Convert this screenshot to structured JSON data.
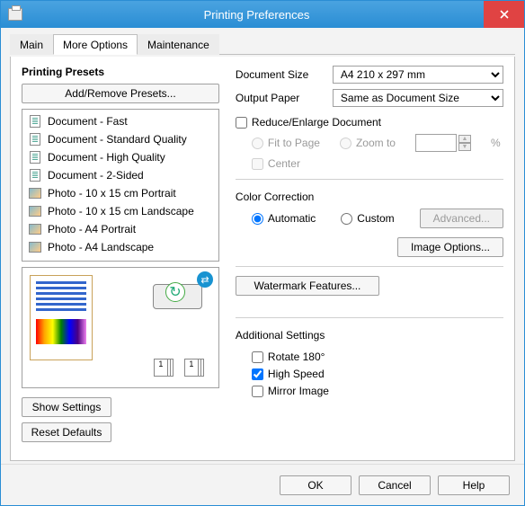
{
  "window": {
    "title": "Printing Preferences"
  },
  "tabs": {
    "main": "Main",
    "more": "More Options",
    "maint": "Maintenance"
  },
  "left": {
    "heading": "Printing Presets",
    "add_remove": "Add/Remove Presets...",
    "presets": [
      "Document - Fast",
      "Document - Standard Quality",
      "Document - High Quality",
      "Document - 2-Sided",
      "Photo - 10 x 15 cm Portrait",
      "Photo - 10 x 15 cm Landscape",
      "Photo - A4 Portrait",
      "Photo - A4 Landscape"
    ],
    "show_settings": "Show Settings",
    "reset_defaults": "Reset Defaults"
  },
  "right": {
    "doc_size_lbl": "Document Size",
    "doc_size_val": "A4 210 x 297 mm",
    "out_paper_lbl": "Output Paper",
    "out_paper_val": "Same as Document Size",
    "reduce_enlarge": "Reduce/Enlarge Document",
    "fit_to_page": "Fit to Page",
    "zoom_to": "Zoom to",
    "zoom_value": "",
    "percent": "%",
    "center": "Center",
    "color_corr": "Color Correction",
    "automatic": "Automatic",
    "custom": "Custom",
    "advanced": "Advanced...",
    "image_options": "Image Options...",
    "watermark": "Watermark Features...",
    "additional": "Additional Settings",
    "rotate": "Rotate 180°",
    "high_speed": "High Speed",
    "mirror": "Mirror Image"
  },
  "footer": {
    "ok": "OK",
    "cancel": "Cancel",
    "help": "Help"
  }
}
